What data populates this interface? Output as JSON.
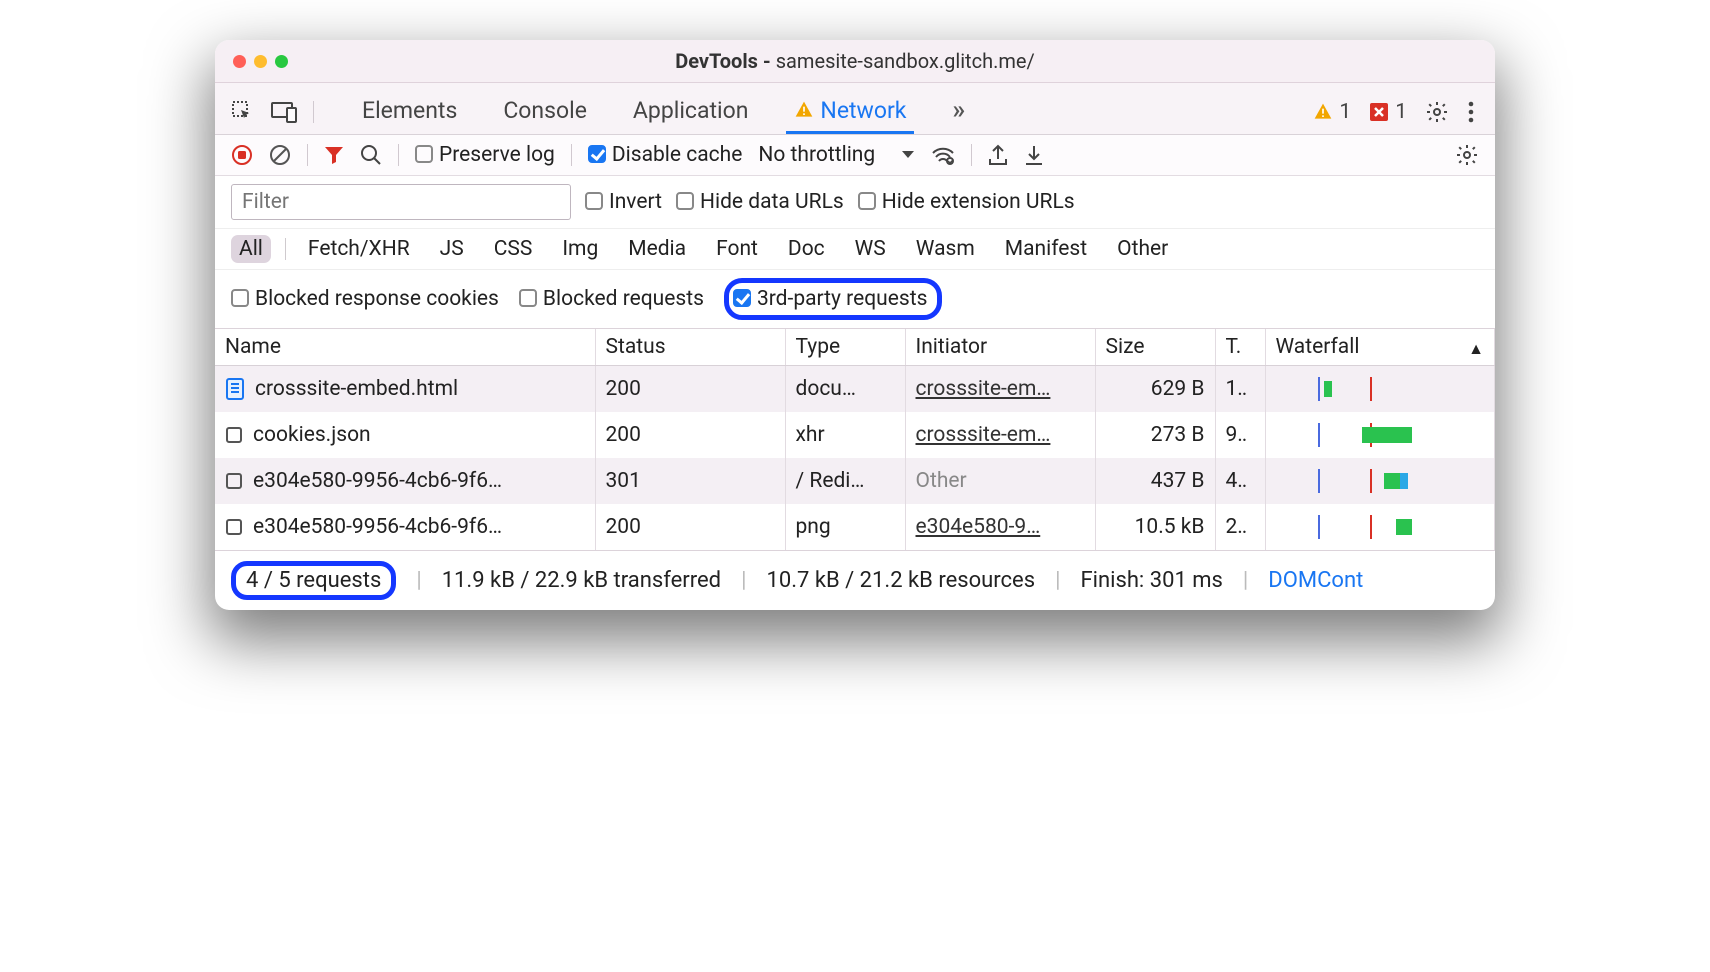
{
  "title": {
    "prefix": "DevTools - ",
    "url": "samesite-sandbox.glitch.me/"
  },
  "tabs": {
    "elements": "Elements",
    "console": "Console",
    "application": "Application",
    "network": "Network",
    "more": "»"
  },
  "counters": {
    "warn": "1",
    "err": "1"
  },
  "toolbar": {
    "preserve": "Preserve log",
    "disable_cache": "Disable cache",
    "throttling": "No throttling"
  },
  "filter": {
    "placeholder": "Filter",
    "invert": "Invert",
    "hide_data": "Hide data URLs",
    "hide_ext": "Hide extension URLs"
  },
  "types": {
    "all": "All",
    "xhr": "Fetch/XHR",
    "js": "JS",
    "css": "CSS",
    "img": "Img",
    "media": "Media",
    "font": "Font",
    "doc": "Doc",
    "ws": "WS",
    "wasm": "Wasm",
    "manifest": "Manifest",
    "other": "Other"
  },
  "checks": {
    "brc": "Blocked response cookies",
    "blk": "Blocked requests",
    "tpr": "3rd-party requests"
  },
  "cols": {
    "name": "Name",
    "status": "Status",
    "type": "Type",
    "init": "Initiator",
    "size": "Size",
    "time": "T.",
    "wf": "Waterfall"
  },
  "rows": [
    {
      "name": "crosssite-embed.html",
      "icon": "doc",
      "status": "200",
      "type": "docu…",
      "init": "crosssite-em…",
      "initlink": true,
      "size": "629 B",
      "time": "1‥",
      "wf": {
        "start": 48,
        "len": 8,
        "color": "#2ac24f"
      }
    },
    {
      "name": "cookies.json",
      "icon": "box",
      "status": "200",
      "type": "xhr",
      "init": "crosssite-em…",
      "initlink": true,
      "size": "273 B",
      "time": "9‥",
      "wf": {
        "start": 86,
        "len": 50,
        "color": "#2ac24f"
      }
    },
    {
      "name": "e304e580-9956-4cb6-9f6…",
      "icon": "box",
      "status": "301",
      "type": "/ Redi…",
      "init": "Other",
      "initlink": false,
      "size": "437 B",
      "time": "4‥",
      "wf": {
        "start": 108,
        "len": 22,
        "color": "#2ac24f",
        "extra": "#2aa8e6"
      }
    },
    {
      "name": "e304e580-9956-4cb6-9f6…",
      "icon": "box",
      "status": "200",
      "type": "png",
      "init": "e304e580-9…",
      "initlink": true,
      "size": "10.5 kB",
      "time": "2‥",
      "wf": {
        "start": 120,
        "len": 16,
        "color": "#2ac24f"
      }
    }
  ],
  "status": {
    "req": "4 / 5 requests",
    "xfer": "11.9 kB / 22.9 kB transferred",
    "res": "10.7 kB / 21.2 kB resources",
    "fin": "Finish: 301 ms",
    "dom": "DOMCont"
  }
}
